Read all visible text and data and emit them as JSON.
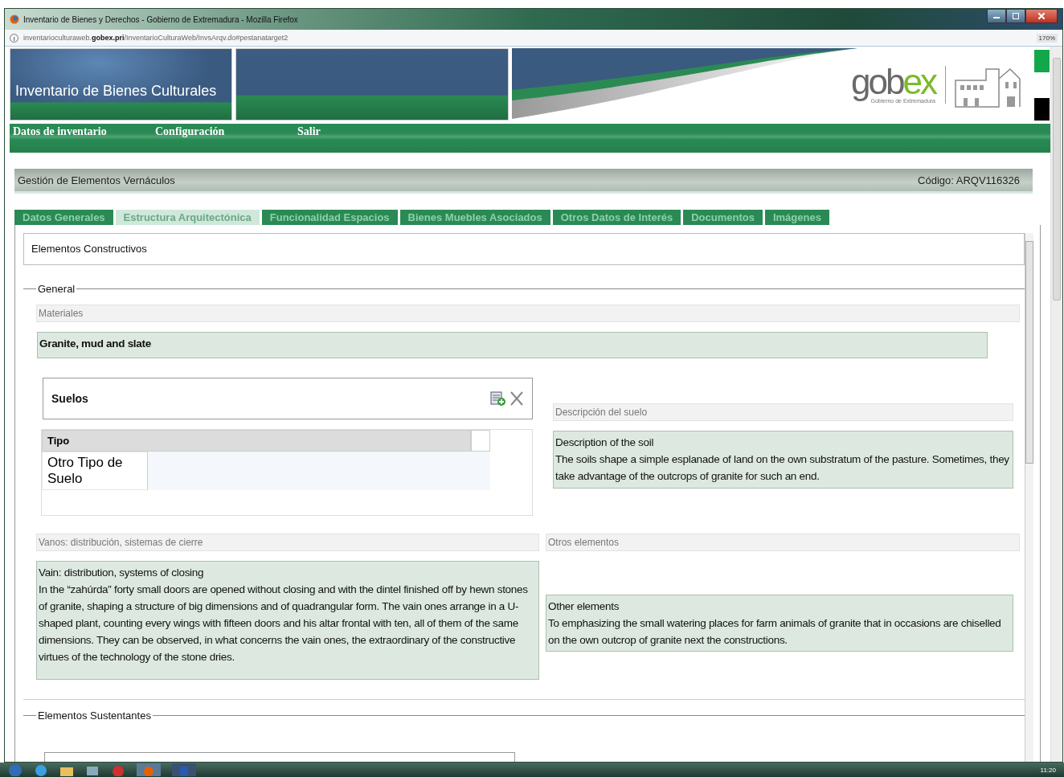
{
  "window": {
    "title": "Inventario de Bienes y Derechos - Gobierno de Extremadura - Mozilla Firefox",
    "address": "inventarioculturaweb.**gobex.pri**/InventarioCulturaWeb/InvsArqv.do#pestanatarget2",
    "zoom": "170%"
  },
  "banner": {
    "title": "Inventario de Bienes Culturales",
    "logo": "gob",
    "logo_accent": "ex",
    "logo_caption": "Gobierno de Extremadura"
  },
  "menu": [
    "Datos de inventario",
    "Configuración",
    "Salir"
  ],
  "header": {
    "title": "Gestión de Elementos Vernáculos",
    "code": "Código: ARQV116326"
  },
  "tabs": [
    {
      "label": "Datos Generales",
      "selected": false
    },
    {
      "label": "Estructura Arquitectónica",
      "selected": true
    },
    {
      "label": "Funcionalidad Espacios",
      "selected": false
    },
    {
      "label": "Bienes Muebles Asociados",
      "selected": false
    },
    {
      "label": "Otros Datos de Interés",
      "selected": false
    },
    {
      "label": "Documentos",
      "selected": false
    },
    {
      "label": "Imágenes",
      "selected": false
    }
  ],
  "section_title": "Elementos Constructivos",
  "general": {
    "legend": "General",
    "materials": {
      "label": "Materiales",
      "value": "Granite, mud and slate"
    },
    "floors": {
      "title": "Suelos",
      "columns": [
        "Tipo"
      ],
      "rows": [
        [
          "Otro Tipo de Suelo"
        ]
      ]
    },
    "floor_description": {
      "label": "Descripción del suelo",
      "value": "Description of the soil\nThe soils shape a simple esplanade of land on the own substratum of the pasture. Sometimes, they take advantage of the outcrops of granite for such an end."
    },
    "openings": {
      "label": "Vanos: distribución, sistemas de cierre",
      "value": "Vain: distribution, systems of closing\nIn the “zahúrda” forty small doors are opened without closing and with the dintel finished off by hewn stones of granite, shaping a structure of big dimensions and of quadrangular form. The vain ones arrange in a U-shaped plant, counting every wings with fifteen doors and his altar frontal with ten, all of them of the same dimensions. They can be observed, in what concerns the vain ones, the extraordinary of the constructive virtues of the technology of the stone dries."
    },
    "other": {
      "label": "Otros elementos",
      "value": "Other elements\nTo emphasizing the small watering places for farm animals of granite that in occasions are chiselled on the own outcrop of granite next the constructions."
    }
  },
  "supporting": {
    "legend": "Elementos Sustentantes"
  },
  "taskbar": {
    "clock": "11:20"
  }
}
